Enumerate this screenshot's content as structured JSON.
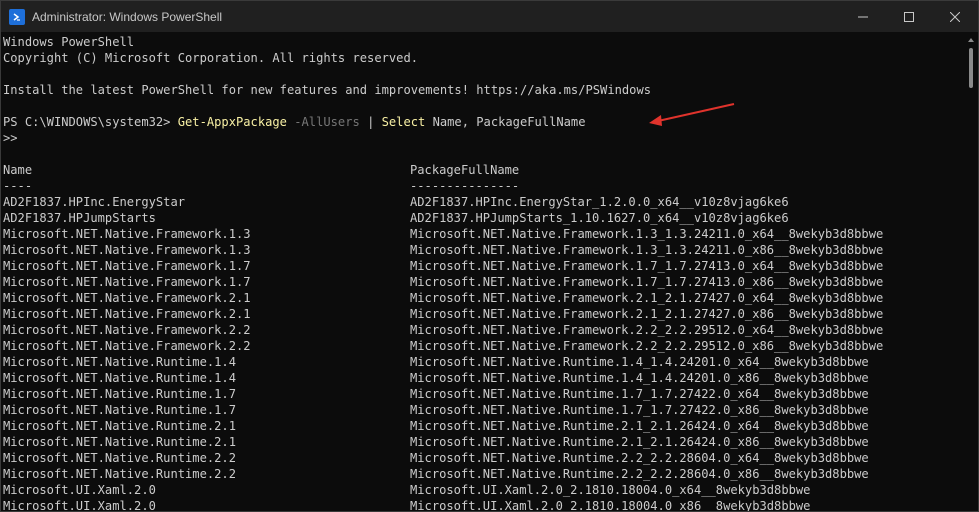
{
  "window": {
    "title": "Administrator: Windows PowerShell"
  },
  "header_lines": [
    "Windows PowerShell",
    "Copyright (C) Microsoft Corporation. All rights reserved.",
    "",
    "Install the latest PowerShell for new features and improvements! https://aka.ms/PSWindows",
    ""
  ],
  "prompt": {
    "path": "PS C:\\WINDOWS\\system32> ",
    "command": "Get-AppxPackage",
    "param": "-AllUsers",
    "pipe": "|",
    "select_cmd": "Select",
    "select_args": "Name, PackageFullName",
    "continuation": ">>"
  },
  "table": {
    "columns": [
      "Name",
      "PackageFullName"
    ],
    "underlines": [
      "----",
      "---------------"
    ],
    "rows": [
      [
        "AD2F1837.HPInc.EnergyStar",
        "AD2F1837.HPInc.EnergyStar_1.2.0.0_x64__v10z8vjag6ke6"
      ],
      [
        "AD2F1837.HPJumpStarts",
        "AD2F1837.HPJumpStarts_1.10.1627.0_x64__v10z8vjag6ke6"
      ],
      [
        "Microsoft.NET.Native.Framework.1.3",
        "Microsoft.NET.Native.Framework.1.3_1.3.24211.0_x64__8wekyb3d8bbwe"
      ],
      [
        "Microsoft.NET.Native.Framework.1.3",
        "Microsoft.NET.Native.Framework.1.3_1.3.24211.0_x86__8wekyb3d8bbwe"
      ],
      [
        "Microsoft.NET.Native.Framework.1.7",
        "Microsoft.NET.Native.Framework.1.7_1.7.27413.0_x64__8wekyb3d8bbwe"
      ],
      [
        "Microsoft.NET.Native.Framework.1.7",
        "Microsoft.NET.Native.Framework.1.7_1.7.27413.0_x86__8wekyb3d8bbwe"
      ],
      [
        "Microsoft.NET.Native.Framework.2.1",
        "Microsoft.NET.Native.Framework.2.1_2.1.27427.0_x64__8wekyb3d8bbwe"
      ],
      [
        "Microsoft.NET.Native.Framework.2.1",
        "Microsoft.NET.Native.Framework.2.1_2.1.27427.0_x86__8wekyb3d8bbwe"
      ],
      [
        "Microsoft.NET.Native.Framework.2.2",
        "Microsoft.NET.Native.Framework.2.2_2.2.29512.0_x64__8wekyb3d8bbwe"
      ],
      [
        "Microsoft.NET.Native.Framework.2.2",
        "Microsoft.NET.Native.Framework.2.2_2.2.29512.0_x86__8wekyb3d8bbwe"
      ],
      [
        "Microsoft.NET.Native.Runtime.1.4",
        "Microsoft.NET.Native.Runtime.1.4_1.4.24201.0_x64__8wekyb3d8bbwe"
      ],
      [
        "Microsoft.NET.Native.Runtime.1.4",
        "Microsoft.NET.Native.Runtime.1.4_1.4.24201.0_x86__8wekyb3d8bbwe"
      ],
      [
        "Microsoft.NET.Native.Runtime.1.7",
        "Microsoft.NET.Native.Runtime.1.7_1.7.27422.0_x64__8wekyb3d8bbwe"
      ],
      [
        "Microsoft.NET.Native.Runtime.1.7",
        "Microsoft.NET.Native.Runtime.1.7_1.7.27422.0_x86__8wekyb3d8bbwe"
      ],
      [
        "Microsoft.NET.Native.Runtime.2.1",
        "Microsoft.NET.Native.Runtime.2.1_2.1.26424.0_x64__8wekyb3d8bbwe"
      ],
      [
        "Microsoft.NET.Native.Runtime.2.1",
        "Microsoft.NET.Native.Runtime.2.1_2.1.26424.0_x86__8wekyb3d8bbwe"
      ],
      [
        "Microsoft.NET.Native.Runtime.2.2",
        "Microsoft.NET.Native.Runtime.2.2_2.2.28604.0_x64__8wekyb3d8bbwe"
      ],
      [
        "Microsoft.NET.Native.Runtime.2.2",
        "Microsoft.NET.Native.Runtime.2.2_2.2.28604.0_x86__8wekyb3d8bbwe"
      ],
      [
        "Microsoft.UI.Xaml.2.0",
        "Microsoft.UI.Xaml.2.0_2.1810.18004.0_x64__8wekyb3d8bbwe"
      ],
      [
        "Microsoft.UI.Xaml.2.0",
        "Microsoft.UI.Xaml.2.0_2.1810.18004.0_x86__8wekyb3d8bbwe"
      ]
    ]
  },
  "colors": {
    "background": "#0c0c0c",
    "titlebar": "#202020",
    "text": "#cccccc",
    "command": "#f9f1a5",
    "parameter": "#767676",
    "annotation_arrow": "#e0332c"
  },
  "icons": {
    "app": "powershell-icon",
    "minimize": "minimize-icon",
    "maximize": "maximize-icon",
    "close": "close-icon"
  }
}
